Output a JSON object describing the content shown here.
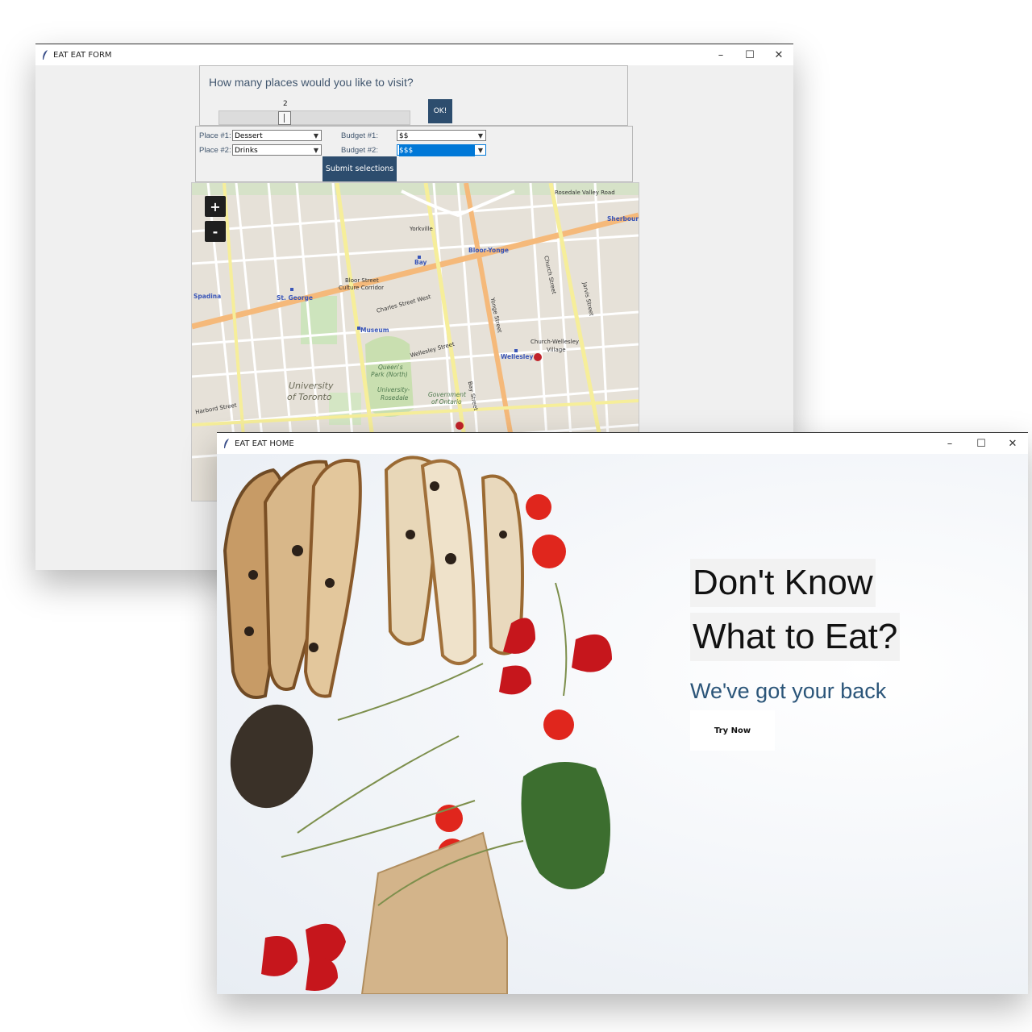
{
  "form_window": {
    "title": "EAT EAT FORM",
    "minimize_glyph": "–",
    "maximize_glyph": "☐",
    "close_glyph": "✕",
    "question": "How many places would you like to visit?",
    "slider_value": "2",
    "slider_level": 2,
    "ok_label": "OK!",
    "place1_label": "Place #1:",
    "place1_value": "Dessert",
    "place2_label": "Place #2:",
    "place2_value": "Drinks",
    "budget1_label": "Budget #1:",
    "budget1_value": "$$",
    "budget2_label": "Budget #2:",
    "budget2_value": "$$$",
    "submit_label": "Submit selections",
    "map": {
      "zoom_in": "+",
      "zoom_out": "-",
      "labels": [
        "Rosedale Valley Road",
        "Sherbourne",
        "Yorkville",
        "Bay",
        "Bloor-Yonge",
        "Spadina",
        "St. George",
        "Bloor Street",
        "Culture Corridor",
        "Museum",
        "Queen's",
        "Park (North)",
        "University",
        "of Toronto",
        "University-",
        "Rosedale",
        "Government",
        "of Ontario",
        "Wellesley",
        "Church-Wellesley",
        "Village",
        "Yonge Street",
        "Bay Street",
        "Church Street",
        "Jarvis Street",
        "Harbord Street",
        "Charles Street West",
        "Wellesley Street"
      ]
    }
  },
  "home_window": {
    "title": "EAT EAT HOME",
    "minimize_glyph": "–",
    "maximize_glyph": "☐",
    "close_glyph": "✕",
    "headline_line1": "Don't Know",
    "headline_line2": "What to Eat?",
    "subheadline": "We've got your back",
    "cta_label": "Try Now"
  },
  "colors": {
    "accent_button": "#2d4d6e",
    "label_text": "#41566e",
    "subheadline": "#2b5579",
    "selection": "#0078d7"
  },
  "icons": [
    "feather-icon",
    "minimize-icon",
    "maximize-icon",
    "close-icon",
    "dropdown-arrow-icon"
  ]
}
